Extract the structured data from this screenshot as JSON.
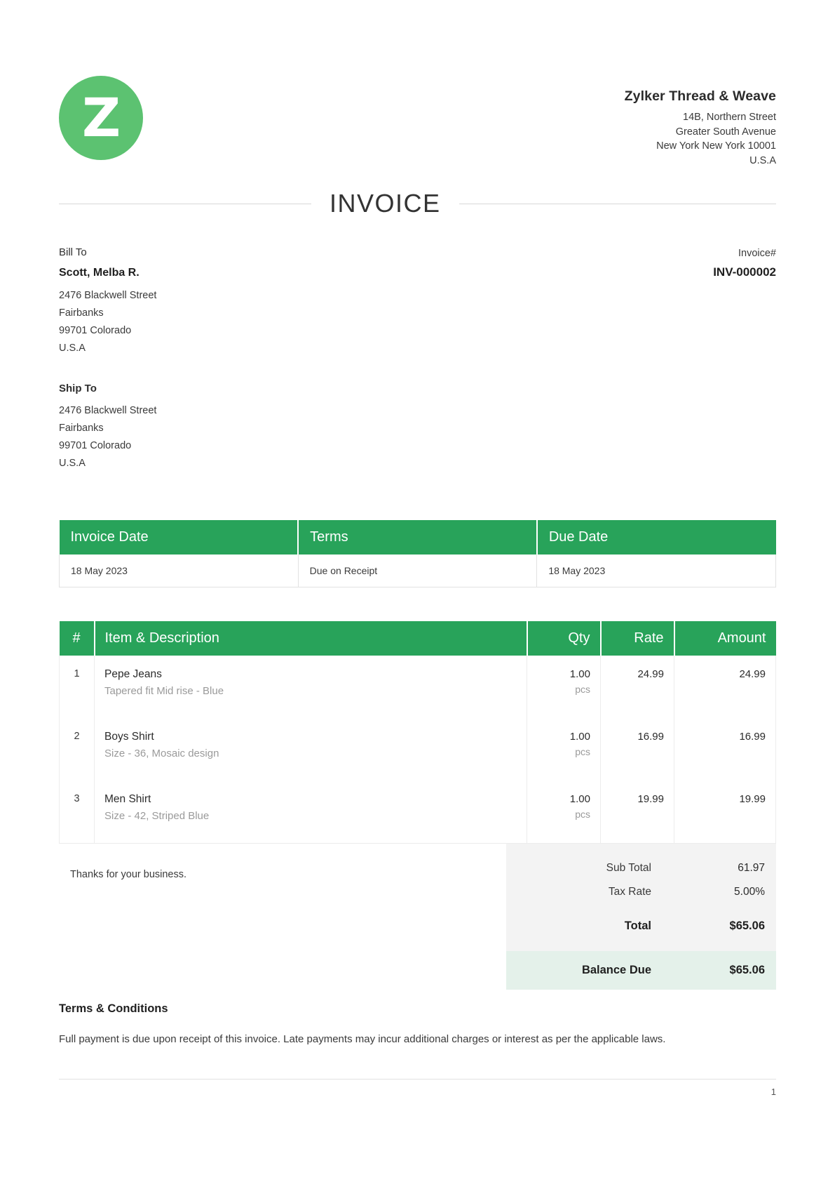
{
  "brand": {
    "logo_letter": "Z",
    "accent_green": "#28a35a",
    "logo_green": "#5cc271",
    "balance_bg": "#e4f1ea",
    "totals_bg": "#f3f3f3"
  },
  "company": {
    "name": "Zylker Thread & Weave",
    "address_line1": "14B, Northern Street",
    "address_line2": "Greater South Avenue",
    "address_line3": "New York New York 10001",
    "address_line4": "U.S.A"
  },
  "document": {
    "title": "INVOICE",
    "invoice_hash_label": "Invoice#",
    "invoice_number": "INV-000002"
  },
  "bill_to": {
    "label": "Bill To",
    "name": "Scott, Melba R.",
    "line1": "2476 Blackwell Street",
    "line2": "Fairbanks",
    "line3": "99701 Colorado",
    "line4": "U.S.A"
  },
  "ship_to": {
    "label": "Ship To",
    "line1": "2476 Blackwell Street",
    "line2": "Fairbanks",
    "line3": "99701 Colorado",
    "line4": "U.S.A"
  },
  "date_table": {
    "headers": [
      "Invoice Date",
      "Terms",
      "Due Date"
    ],
    "values": [
      "18 May 2023",
      "Due on Receipt",
      "18 May 2023"
    ]
  },
  "items_table": {
    "headers": {
      "num": "#",
      "description": "Item & Description",
      "qty": "Qty",
      "rate": "Rate",
      "amount": "Amount"
    },
    "rows": [
      {
        "num": "1",
        "name": "Pepe Jeans",
        "description": "Tapered fit Mid rise - Blue",
        "qty": "1.00",
        "unit": "pcs",
        "rate": "24.99",
        "amount": "24.99"
      },
      {
        "num": "2",
        "name": "Boys Shirt",
        "description": "Size - 36, Mosaic design",
        "qty": "1.00",
        "unit": "pcs",
        "rate": "16.99",
        "amount": "16.99"
      },
      {
        "num": "3",
        "name": "Men Shirt",
        "description": "Size - 42, Striped Blue",
        "qty": "1.00",
        "unit": "pcs",
        "rate": "19.99",
        "amount": "19.99"
      }
    ]
  },
  "thanks_note": "Thanks for your business.",
  "totals": {
    "sub_total_label": "Sub Total",
    "sub_total_value": "61.97",
    "tax_rate_label": "Tax Rate",
    "tax_rate_value": "5.00%",
    "total_label": "Total",
    "total_value": "$65.06",
    "balance_due_label": "Balance Due",
    "balance_due_value": "$65.06"
  },
  "terms": {
    "title": "Terms & Conditions",
    "body": "Full payment is due upon receipt of this invoice. Late payments may incur additional charges or interest as per the applicable laws."
  },
  "footer": {
    "page_number": "1"
  }
}
